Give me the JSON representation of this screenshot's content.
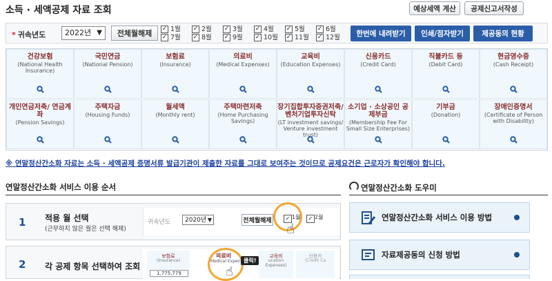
{
  "header": {
    "title": "소득 · 세액공제 자료 조회",
    "btn_estimate": "예상세액 계산",
    "btn_report": "공제신고서작성"
  },
  "filter": {
    "year_label": "귀속년도",
    "year_value": "2022년",
    "clear_button": "전체월해제",
    "months_top": [
      "1월",
      "2월",
      "3월",
      "4월",
      "5월",
      "6월"
    ],
    "months_bottom": [
      "7월",
      "8월",
      "9월",
      "10월",
      "11월",
      "12월"
    ],
    "btn_download": "한번에 내려받기",
    "btn_print": "인쇄/점자받기",
    "btn_agree": "제공동의 현황"
  },
  "categories": [
    {
      "ko": "건강보험",
      "en": "(National Health Insurance)"
    },
    {
      "ko": "국민연금",
      "en": "(National Pension)"
    },
    {
      "ko": "보험료",
      "en": "(Insurance)"
    },
    {
      "ko": "의료비",
      "en": "(Medical Expenses)"
    },
    {
      "ko": "교육비",
      "en": "(Education Expenses)"
    },
    {
      "ko": "신용카드",
      "en": "(Credit Card)"
    },
    {
      "ko": "직불카드 등",
      "en": "(Debit Card)"
    },
    {
      "ko": "현금영수증",
      "en": "(Cash Receipt)"
    },
    {
      "ko": "개인연금저축/ 연금계좌",
      "en": "(Pension Savings)"
    },
    {
      "ko": "주택자금",
      "en": "(Housing Funds)"
    },
    {
      "ko": "월세액",
      "en": "(Monthly rent)"
    },
    {
      "ko": "주택마련저축",
      "en": "(Home Purchasing Savings)"
    },
    {
      "ko": "장기집합투자증권저축/ 벤처기업투자신탁",
      "en": "(LT investment savings/ Venture investment trust)"
    },
    {
      "ko": "소기업 · 소상공인 공제부금",
      "en": "(Membership Fee For Small Size Enterprises)"
    },
    {
      "ko": "기부금",
      "en": "(Donation)"
    },
    {
      "ko": "장애인증명서",
      "en": "(Certificate of Person with Disability)"
    }
  ],
  "notice": "※ 연말정산간소화 자료는 소득 · 세액공제 증명서류 발급기관이 제출한 자료를 그대로 보여주는 것이므로 공제요건은 근로자가 확인해야 합니다.",
  "steps_section": {
    "title": "연말정산간소화 서비스 이용 순서",
    "steps": [
      {
        "num": "1",
        "head": "적용 월 선택",
        "sub": "(근무하지 않은 월은 선택 해제)",
        "demo": {
          "year_label": "귀속년도",
          "year": "2020년",
          "clear": "전체월해제",
          "m1": "1월",
          "m2": "2월"
        }
      },
      {
        "num": "2",
        "head": "각 공제 항목 선택하여 조회",
        "sub": "",
        "demo": {
          "c1": "보험료",
          "c1en": "(Insurance)",
          "c2": "의료비",
          "c2en": "Medical Expen",
          "c3": "교육비",
          "c3en": "ucation Expenses)",
          "c4": "신용카",
          "c4en": "(Credit Ca",
          "value": "1,775,779",
          "click": "클릭!"
        }
      }
    ]
  },
  "help_section": {
    "title": "연말정산간소화 도우미",
    "items": [
      "연말정산간소화 서비스 이용 방법",
      "자료제공동의 신청 방법"
    ]
  },
  "colors": {
    "accent": "#2b5ea8",
    "category_text": "#8a2b2b",
    "cell_bg": "#f0f8fd"
  },
  "icons": [
    "search-icon",
    "checkbox-icon",
    "pencil-doc-icon",
    "chat-doc-icon",
    "help-headset-icon",
    "cursor-hand-icon"
  ]
}
